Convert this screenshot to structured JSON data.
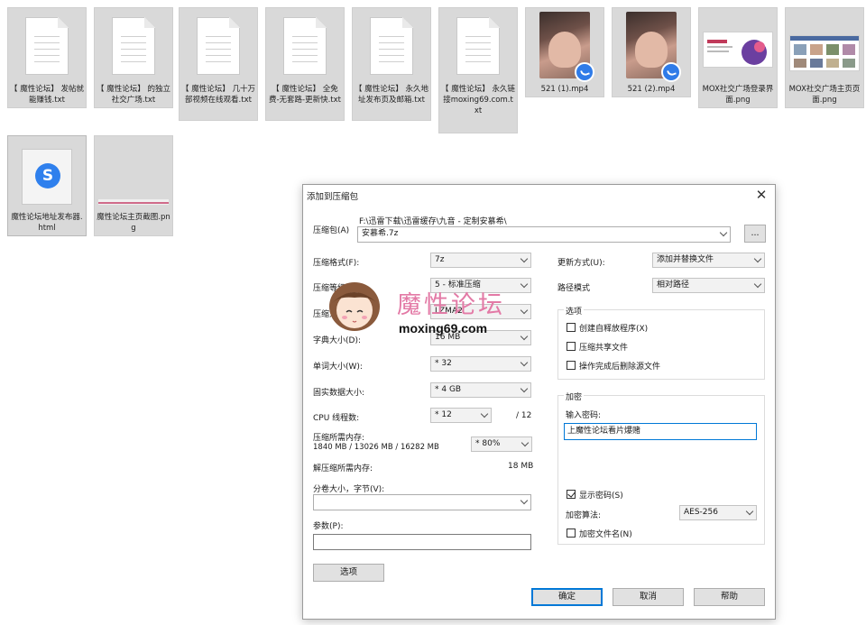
{
  "files": [
    {
      "name": "【 魔性论坛】 发帖就能赚钱.txt",
      "kind": "txt"
    },
    {
      "name": "【 魔性论坛】 的独立社交广场.txt",
      "kind": "txt"
    },
    {
      "name": "【 魔性论坛】 几十万部视频在线观看.txt",
      "kind": "txt"
    },
    {
      "name": "【 魔性论坛】 全免费-无套路-更新快.txt",
      "kind": "txt"
    },
    {
      "name": "【 魔性论坛】 永久地址发布页及邮箱.txt",
      "kind": "txt"
    },
    {
      "name": "【 魔性论坛】 永久链接moxing69.com.txt",
      "kind": "txt"
    },
    {
      "name": "521 (1).mp4",
      "kind": "mp4"
    },
    {
      "name": "521 (2).mp4",
      "kind": "mp4"
    },
    {
      "name": "MOX社交广场登录界面.png",
      "kind": "png"
    },
    {
      "name": "MOX社交广场主页页面.png",
      "kind": "png"
    },
    {
      "name": "魔性论坛地址发布器.html",
      "kind": "html"
    },
    {
      "name": "魔性论坛主页截图.png",
      "kind": "png"
    }
  ],
  "dialog": {
    "title": "添加到压缩包",
    "close_icon": "close-icon",
    "archive_label": "压缩包(A)",
    "archive_path": "F:\\迅雷下载\\迅雷缓存\\九音 - 定制安慕希\\",
    "archive_name": "安慕希.7z",
    "browse_label": "...",
    "format_label": "压缩格式(F):",
    "format_value": "7z",
    "level_label": "压缩等级(L):",
    "level_value": "5 - 标准压缩",
    "method_label": "压缩方法(M):",
    "method_value": "LZMA2",
    "dict_label": "字典大小(D):",
    "dict_value": "16 MB",
    "word_label": "单词大小(W):",
    "word_value": "* 32",
    "solid_label": "固实数据大小:",
    "solid_value": "* 4 GB",
    "cpu_label": "CPU 线程数:",
    "cpu_value": "* 12",
    "cpu_total": "/ 12",
    "mem_label": "压缩所需内存:",
    "mem_detail": "1840 MB / 13026 MB / 16282 MB",
    "mem_percent": "* 80%",
    "decomp_label": "解压缩所需内存:",
    "decomp_value": "18 MB",
    "split_label": "分卷大小，字节(V):",
    "split_value": "",
    "params_label": "参数(P):",
    "params_value": "",
    "options_button": "选项",
    "update_label": "更新方式(U):",
    "update_value": "添加并替换文件",
    "pathmode_label": "路径模式",
    "pathmode_value": "相对路径",
    "options_group": "选项",
    "opt_sfx": "创建自释放程序(X)",
    "opt_shared": "压缩共享文件",
    "opt_delete": "操作完成后删除源文件",
    "encrypt_group": "加密",
    "password_label": "输入密码:",
    "password_value": "上魔性论坛看片爆赌",
    "show_password": "显示密码(S)",
    "show_password_checked": true,
    "algo_label": "加密算法:",
    "algo_value": "AES-256",
    "encrypt_names": "加密文件名(N)",
    "ok_button": "确定",
    "cancel_button": "取消",
    "help_button": "帮助"
  },
  "watermark": {
    "title": "魔性论坛",
    "url": "moxing69.com"
  }
}
